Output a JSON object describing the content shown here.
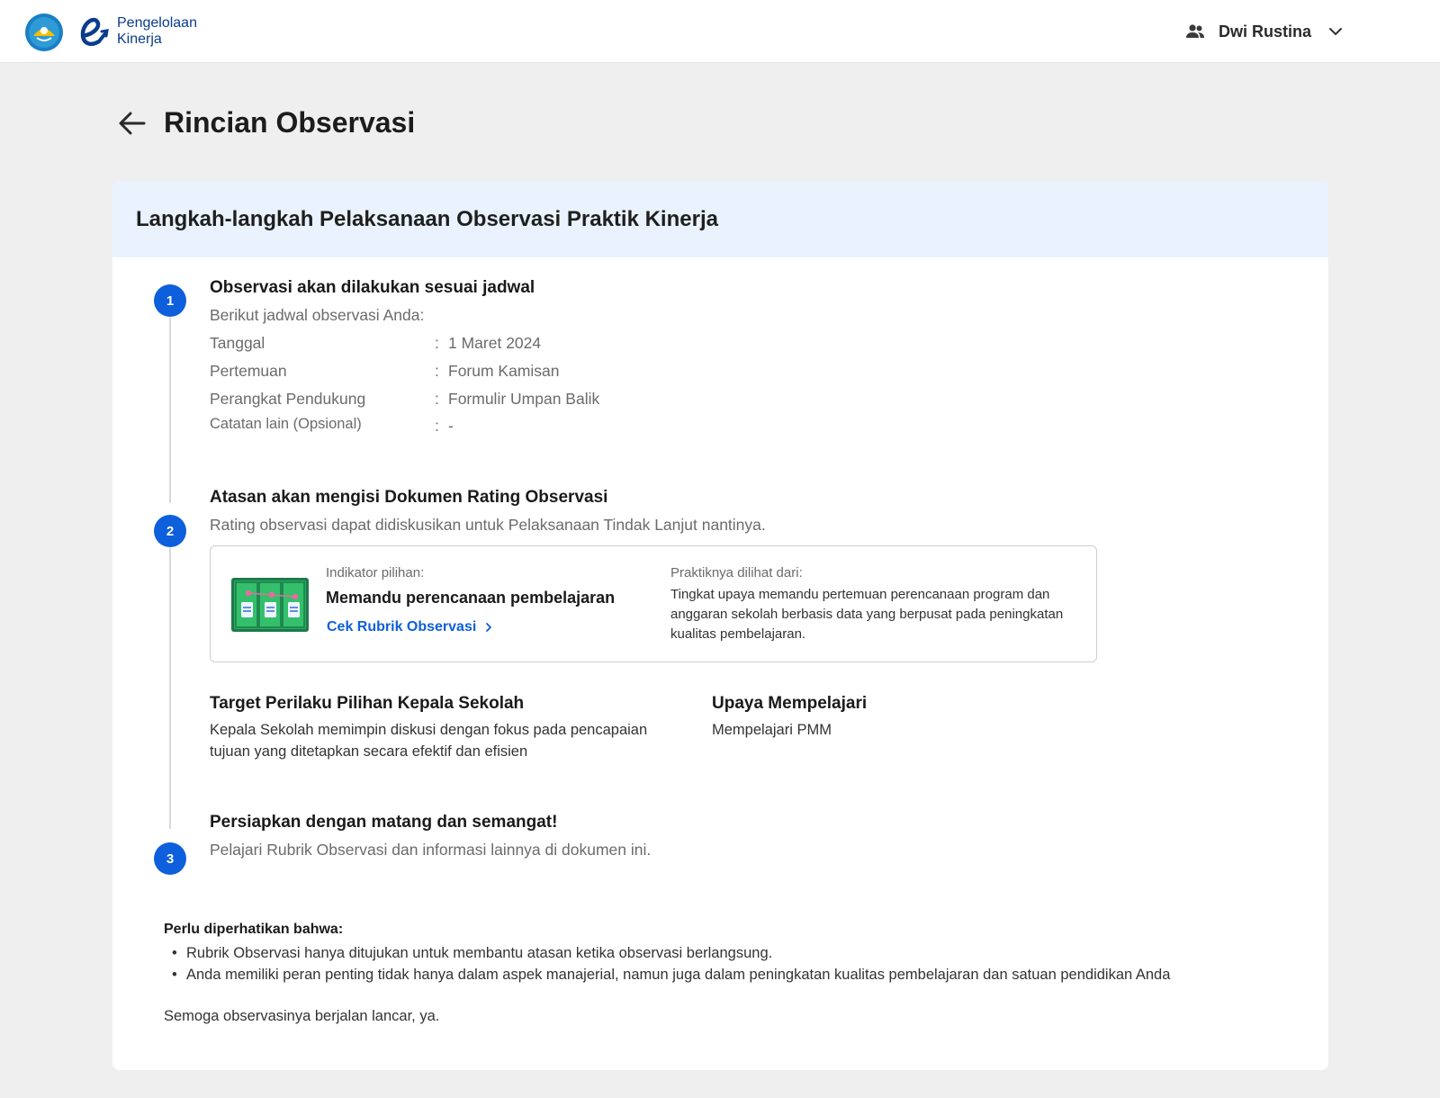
{
  "header": {
    "brand_line1": "Pengelolaan",
    "brand_line2": "Kinerja",
    "user_name": "Dwi Rustina",
    "icons": {
      "emblem": "tut-wuri-handayani-logo",
      "brand": "e-kinerja-logo",
      "user": "users-icon",
      "dropdown": "chevron-down-icon"
    }
  },
  "page": {
    "title": "Rincian Observasi",
    "back_icon": "arrow-left-icon"
  },
  "card": {
    "title": "Langkah-langkah Pelaksanaan Observasi Praktik Kinerja",
    "step_numbers": [
      "1",
      "2",
      "3"
    ],
    "step1": {
      "title": "Observasi akan dilakukan sesuai jadwal",
      "subtitle": "Berikut jadwal observasi Anda:",
      "schedule": [
        {
          "label": "Tanggal",
          "value": "1 Maret 2024"
        },
        {
          "label": "Pertemuan",
          "value": "Forum Kamisan"
        },
        {
          "label": "Perangkat Pendukung",
          "value": "Formulir Umpan Balik"
        },
        {
          "label": "Catatan lain (Opsional)",
          "value": "-"
        }
      ],
      "separator": ":"
    },
    "step2": {
      "title": "Atasan akan mengisi Dokumen Rating Observasi",
      "subtitle": "Rating observasi dapat didiskusikan untuk Pelaksanaan Tindak Lanjut nantinya.",
      "indicator": {
        "label": "Indikator pilihan:",
        "value": "Memandu perencanaan pembelajaran",
        "link_label": "Cek Rubrik Observasi",
        "practice_label": "Praktiknya dilihat dari:",
        "practice_desc": "Tingkat upaya memandu pertemuan perencanaan program dan anggaran sekolah berbasis data yang berpusat pada peningkatan kualitas pembelajaran."
      },
      "target": {
        "title": "Target Perilaku Pilihan Kepala Sekolah",
        "text": "Kepala Sekolah memimpin diskusi dengan fokus pada pencapaian tujuan yang ditetapkan secara efektif dan efisien"
      },
      "effort": {
        "title": "Upaya Mempelajari",
        "text": "Mempelajari PMM"
      }
    },
    "step3": {
      "title": "Persiapkan dengan matang dan semangat!",
      "subtitle": "Pelajari Rubrik Observasi dan informasi lainnya di dokumen ini."
    },
    "notes": {
      "title": "Perlu diperhatikan bahwa:",
      "items": [
        "Rubrik Observasi hanya ditujukan untuk membantu atasan ketika observasi berlangsung.",
        "Anda memiliki peran penting tidak hanya dalam aspek manajerial, namun juga dalam peningkatan kualitas pembelajaran dan satuan pendidikan Anda"
      ],
      "closing": "Semoga observasinya berjalan lancar, ya."
    }
  },
  "colors": {
    "primary": "#0d5fdb",
    "header_band": "#e9f2fd",
    "page_bg": "#efefef",
    "brand_text": "#0b3c8c"
  }
}
